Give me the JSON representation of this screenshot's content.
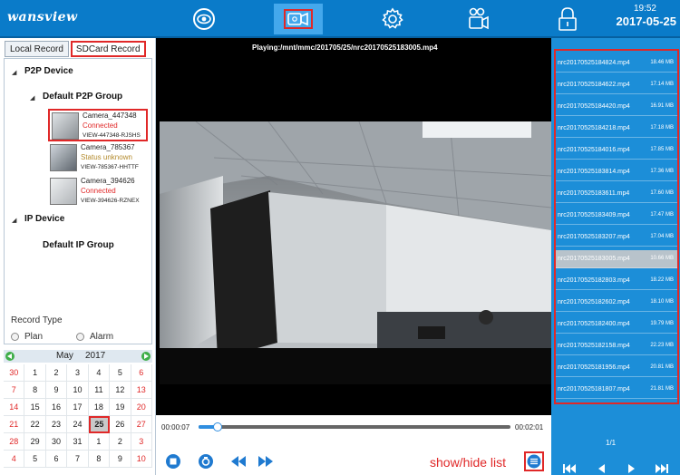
{
  "header": {
    "logo": "wansview",
    "nav": [
      {
        "name": "live-view",
        "icon": "eye-icon",
        "active": false
      },
      {
        "name": "playback",
        "icon": "camera-playback-icon",
        "active": true
      },
      {
        "name": "settings",
        "icon": "gear-icon",
        "active": false
      },
      {
        "name": "devices",
        "icon": "device-icon",
        "active": false
      },
      {
        "name": "lock",
        "icon": "lock-icon",
        "active": false
      }
    ],
    "time": "19:52",
    "date": "2017-05-25"
  },
  "tabs": {
    "local": "Local Record",
    "sdcard": "SDCard Record"
  },
  "tree": {
    "p2p_device": "P2P Device",
    "p2p_group": "Default P2P Group",
    "ip_device": "IP Device",
    "ip_group": "Default IP Group",
    "cameras": [
      {
        "name": "Camera_447348",
        "status": "Connected",
        "uid": "VIEW-447348-RJSHS",
        "selected": true
      },
      {
        "name": "Camera_785367",
        "status": "Status unknown",
        "uid": "VIEW-785367-HHTTF",
        "selected": false
      },
      {
        "name": "Camera_394626",
        "status": "Connected",
        "uid": "VIEW-394626-RZNEX",
        "selected": false
      }
    ]
  },
  "record_type": {
    "title": "Record Type",
    "plan": "Plan",
    "alarm": "Alarm"
  },
  "calendar": {
    "month": "May",
    "year": "2017",
    "selected": "25",
    "days": [
      "30",
      "1",
      "2",
      "3",
      "4",
      "5",
      "6",
      "7",
      "8",
      "9",
      "10",
      "11",
      "12",
      "13",
      "14",
      "15",
      "16",
      "17",
      "18",
      "19",
      "20",
      "21",
      "22",
      "23",
      "24",
      "25",
      "26",
      "27",
      "28",
      "29",
      "30",
      "31",
      "1",
      "2",
      "3",
      "4",
      "5",
      "6",
      "7",
      "8",
      "9",
      "10"
    ]
  },
  "player": {
    "playing": "Playing:/mnt/mmc/201705/25/nrc20170525183005.mp4",
    "current_time": "00:00:07",
    "total_time": "00:02:01",
    "progress": 0.06,
    "show_hide_label": "show/hide list"
  },
  "files": [
    {
      "name": "nrc20170525184824.mp4",
      "size": "18.46 MB"
    },
    {
      "name": "nrc20170525184622.mp4",
      "size": "17.14 MB"
    },
    {
      "name": "nrc20170525184420.mp4",
      "size": "16.91 MB"
    },
    {
      "name": "nrc20170525184218.mp4",
      "size": "17.18 MB"
    },
    {
      "name": "nrc20170525184016.mp4",
      "size": "17.85 MB"
    },
    {
      "name": "nrc20170525183814.mp4",
      "size": "17.36 MB"
    },
    {
      "name": "nrc20170525183611.mp4",
      "size": "17.60 MB"
    },
    {
      "name": "nrc20170525183409.mp4",
      "size": "17.47 MB"
    },
    {
      "name": "nrc20170525183207.mp4",
      "size": "17.04 MB"
    },
    {
      "name": "nrc20170525183005.mp4",
      "size": "10.66 MB",
      "selected": true
    },
    {
      "name": "nrc20170525182803.mp4",
      "size": "18.22 MB"
    },
    {
      "name": "nrc20170525182602.mp4",
      "size": "18.10 MB"
    },
    {
      "name": "nrc20170525182400.mp4",
      "size": "19.79 MB"
    },
    {
      "name": "nrc20170525182158.mp4",
      "size": "22.23 MB"
    },
    {
      "name": "nrc20170525181956.mp4",
      "size": "20.81 MB"
    },
    {
      "name": "nrc20170525181807.mp4",
      "size": "21.81 MB"
    }
  ],
  "pager": {
    "page": "1/1"
  },
  "colors": {
    "brand": "#0a7bc9",
    "list_bg": "#1c8ed8",
    "highlight": "#e02828",
    "connected": "#e02828",
    "unknown": "#b38a2c"
  }
}
